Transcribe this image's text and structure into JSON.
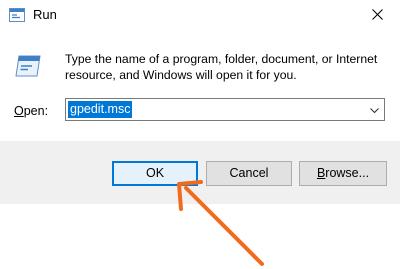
{
  "window": {
    "title": "Run",
    "icon": "run-app-icon",
    "close_icon": "close-icon"
  },
  "body": {
    "description": "Type the name of a program, folder, document, or Internet resource, and Windows will open it for you.",
    "icon": "run-program-icon"
  },
  "open": {
    "label_underlined": "O",
    "label_rest": "pen:",
    "value": "gpedit.msc",
    "dropdown_icon": "chevron-down-icon"
  },
  "buttons": {
    "ok": "OK",
    "cancel": "Cancel",
    "browse_underlined": "B",
    "browse_rest": "rowse..."
  },
  "annotation": {
    "arrow_color": "#f26b1d"
  },
  "colors": {
    "accent": "#0078d7",
    "footer_bg": "#f0f0f0"
  }
}
